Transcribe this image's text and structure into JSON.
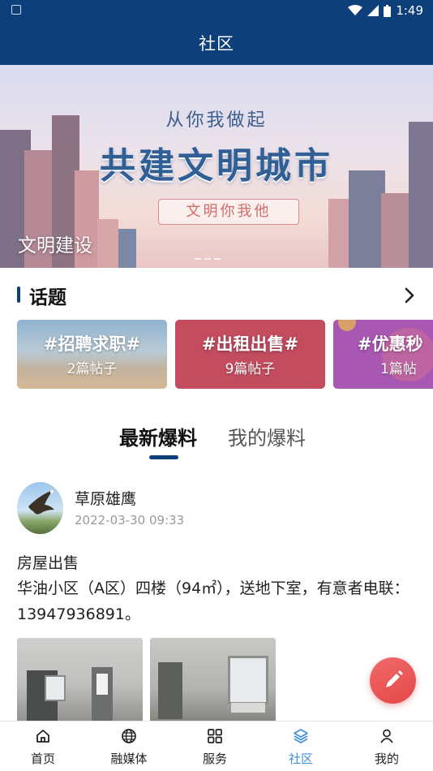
{
  "status_bar": {
    "time": "1:49"
  },
  "header": {
    "title": "社区"
  },
  "banner": {
    "slogan_small": "从你我做起",
    "slogan_big": "共建文明城市",
    "slogan_box": "文明你我他",
    "caption": "文明建设"
  },
  "topics": {
    "heading": "话题",
    "items": [
      {
        "name": "#招聘求职#",
        "count": "2篇帖子"
      },
      {
        "name": "#出租出售#",
        "count": "9篇帖子"
      },
      {
        "name": "#优惠秒",
        "count": "1篇帖"
      }
    ]
  },
  "tabs": {
    "active": "最新爆料",
    "inactive": "我的爆料"
  },
  "post": {
    "author": "草原雄鹰",
    "time": "2022-03-30 09:33",
    "title": "房屋出售",
    "body": "华油小区（A区）四楼（94㎡），送地下室，有意者电联：13947936891。"
  },
  "bottom_nav": {
    "items": [
      {
        "label": "首页",
        "icon": "home-icon"
      },
      {
        "label": "融媒体",
        "icon": "globe-icon"
      },
      {
        "label": "服务",
        "icon": "grid-icon"
      },
      {
        "label": "社区",
        "icon": "layers-icon"
      },
      {
        "label": "我的",
        "icon": "user-icon"
      }
    ],
    "active_index": 3
  },
  "colors": {
    "primary": "#0d3f7a",
    "active_nav": "#3f8fe0",
    "fab": "#e54848"
  }
}
